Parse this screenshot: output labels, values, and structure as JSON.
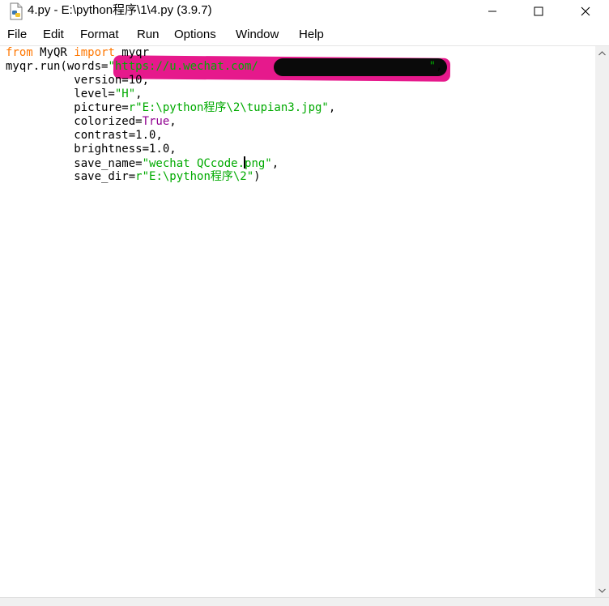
{
  "window": {
    "title": "4.py - E:\\python程序\\1\\4.py (3.9.7)",
    "controls": {
      "minimize": "minimize",
      "maximize": "maximize",
      "close": "close"
    }
  },
  "menu": {
    "items": [
      "File",
      "Edit",
      "Format",
      "Run",
      "Options",
      "Window",
      "Help"
    ]
  },
  "editor": {
    "code": [
      [
        {
          "t": "from",
          "c": "kw-orange"
        },
        {
          "t": " MyQR "
        },
        {
          "t": "import",
          "c": "kw-orange"
        },
        {
          "t": " myqr"
        }
      ],
      [
        {
          "t": "myqr.run(words="
        },
        {
          "t": "\"https://u.wechat.com/",
          "c": "str"
        },
        {
          "t": "                         "
        },
        {
          "t": "\"",
          "c": "str"
        },
        {
          "t": ","
        }
      ],
      [
        {
          "t": "          version=10,"
        }
      ],
      [
        {
          "t": "          level="
        },
        {
          "t": "\"H\"",
          "c": "str"
        },
        {
          "t": ","
        }
      ],
      [
        {
          "t": "          picture="
        },
        {
          "t": "r\"E:\\python程序\\2\\tupian3.jpg\"",
          "c": "str"
        },
        {
          "t": ","
        }
      ],
      [
        {
          "t": "          colorized="
        },
        {
          "t": "True",
          "c": "kw-purple"
        },
        {
          "t": ","
        }
      ],
      [
        {
          "t": "          contrast=1.0,"
        }
      ],
      [
        {
          "t": "          brightness=1.0,"
        }
      ],
      [
        {
          "t": "          save_name="
        },
        {
          "t": "\"wechat QCcode.",
          "c": "str"
        },
        {
          "caret": true
        },
        {
          "t": "png\"",
          "c": "str"
        },
        {
          "t": ","
        }
      ],
      [
        {
          "t": "          save_dir="
        },
        {
          "t": "r\"E:\\python程序\\2\"",
          "c": "str"
        },
        {
          "t": ")"
        }
      ]
    ]
  },
  "colors": {
    "keyword": "#ff7700",
    "builtin": "#900090",
    "string": "#00aa00",
    "redaction_highlight": "#e6198c",
    "redaction_blob": "#0a0a0a"
  }
}
